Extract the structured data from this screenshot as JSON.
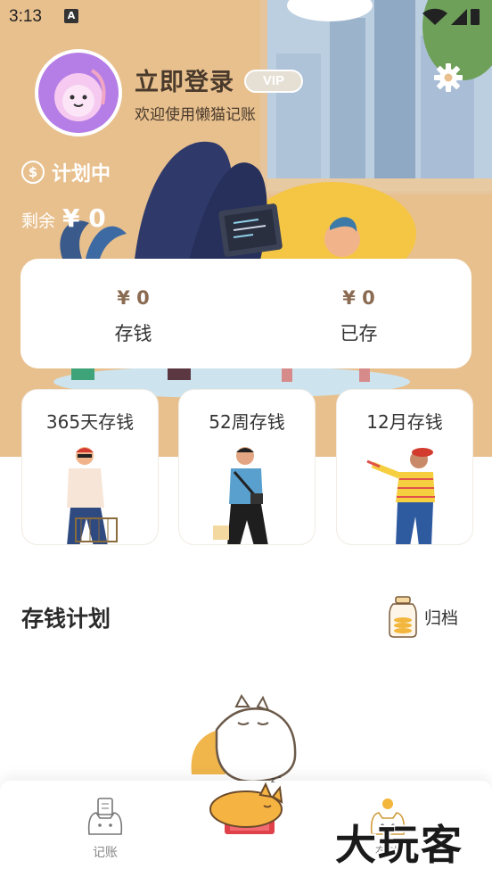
{
  "status_bar": {
    "time": "3:13",
    "notification_glyph": "A",
    "icons": [
      "wifi-icon",
      "signal-icon",
      "battery-icon"
    ]
  },
  "profile": {
    "login_label": "立即登录",
    "vip_label": "VIP",
    "welcome": "欢迎使用懒猫记账",
    "avatar_icon": "monkey-avatar-icon",
    "settings_icon": "gear-icon"
  },
  "plan": {
    "status_label": "计划中",
    "remaining_label": "剩余",
    "remaining_value": "¥ 0"
  },
  "summary": {
    "deposit_value": "¥ 0",
    "deposit_label": "存钱",
    "saved_value": "¥ 0",
    "saved_label": "已存"
  },
  "plan_cards": [
    {
      "title": "365天存钱"
    },
    {
      "title": "52周存钱"
    },
    {
      "title": "12月存钱"
    }
  ],
  "section": {
    "title": "存钱计划",
    "archive_label": "归档",
    "archive_icon": "coin-jar-icon"
  },
  "bottom_nav": {
    "items": [
      {
        "label": "记账",
        "icon": "cat-ledger-icon"
      },
      {
        "label": "sleeping-cat-center-icon"
      },
      {
        "label": "存钱",
        "icon": "cat-savings-icon"
      }
    ],
    "left_label": "记账",
    "right_label": "存钱",
    "watermark": "大玩客"
  },
  "colors": {
    "hero_bg": "#e8c08e",
    "accent_brown": "#8a6b52",
    "card_bg": "#ffffff"
  }
}
